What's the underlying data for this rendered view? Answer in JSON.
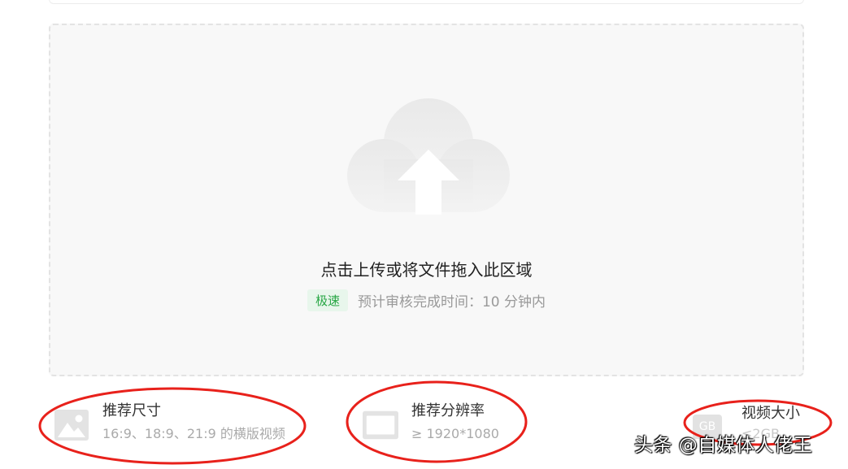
{
  "upload": {
    "title": "点击上传或将文件拖入此区域",
    "speed_badge": "极速",
    "review_time": "预计审核完成时间：10 分钟内"
  },
  "requirements": [
    {
      "icon": "image-icon",
      "title": "推荐尺寸",
      "value": "16:9、18:9、21:9 的横版视频"
    },
    {
      "icon": "screen-icon",
      "title": "推荐分辨率",
      "value": "≥ 1920*1080"
    },
    {
      "icon": "gb-icon",
      "icon_text": "GB",
      "title": "视频大小",
      "value": "≤2GB"
    }
  ],
  "watermark": "头条 @自媒体人佬王",
  "colors": {
    "annotation": "#e8211b",
    "badge_text": "#28a745",
    "badge_bg": "#e8f6ec",
    "dropzone_bg": "#f8f8f8"
  }
}
